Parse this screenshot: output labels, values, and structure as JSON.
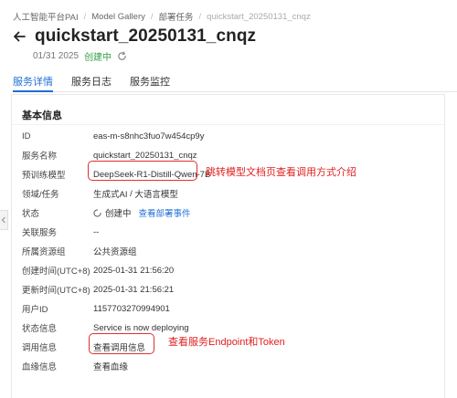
{
  "breadcrumb": {
    "items": [
      "人工智能平台PAI",
      "Model Gallery",
      "部署任务",
      "quickstart_20250131_cnqz"
    ]
  },
  "header": {
    "title": "quickstart_20250131_cnqz",
    "date": "01/31 2025",
    "status": "创建中"
  },
  "tabs": [
    "服务详情",
    "服务日志",
    "服务监控"
  ],
  "card": {
    "title": "基本信息",
    "rows": [
      {
        "label": "ID",
        "value": "eas-m-s8nhc3fuo7w454cp9y"
      },
      {
        "label": "服务名称",
        "value": "quickstart_20250131_cnqz"
      },
      {
        "label": "预训练模型",
        "value": "DeepSeek-R1-Distill-Qwen-7B"
      },
      {
        "label": "领域/任务",
        "value_part1": "生成式AI",
        "value_sep": " / ",
        "value_part2": "大语言模型"
      },
      {
        "label": "状态",
        "value": "创建中",
        "link": "查看部署事件"
      },
      {
        "label": "关联服务",
        "value": "--"
      },
      {
        "label": "所属资源组",
        "value": "公共资源组"
      },
      {
        "label": "创建时间(UTC+8)",
        "value": "2025-01-31 21:56:20"
      },
      {
        "label": "更新时间(UTC+8)",
        "value": "2025-01-31 21:56:21"
      },
      {
        "label": "用户ID",
        "value": "1157703270994901"
      },
      {
        "label": "状态信息",
        "value": "Service is now deploying"
      },
      {
        "label": "调用信息",
        "value": "查看调用信息"
      },
      {
        "label": "血缘信息",
        "value": "查看血缘"
      }
    ]
  },
  "annotations": {
    "model_note": "跳转模型文档页查看调用方式介绍",
    "call_note": "查看服务Endpoint和Token"
  },
  "colors": {
    "accent": "#1f6fd6",
    "status_green": "#2f9e44",
    "annotation_red": "#e02020"
  }
}
